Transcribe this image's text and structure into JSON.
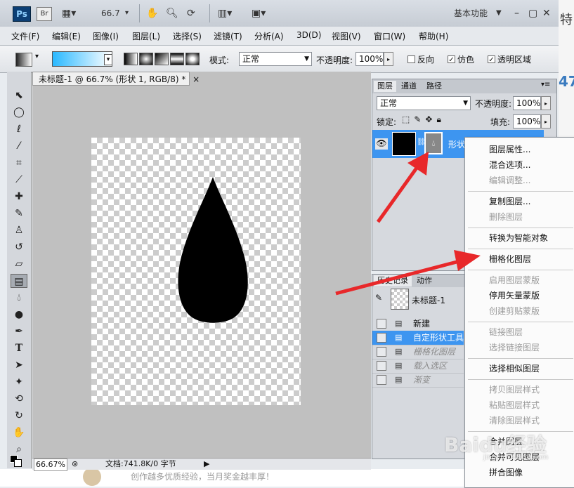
{
  "titlebar": {
    "ps_logo": "Ps",
    "br_logo": "Br",
    "zoom": "66.7",
    "workspace": "基本功能",
    "right_char": "特"
  },
  "menu": [
    "文件(F)",
    "编辑(E)",
    "图像(I)",
    "图层(L)",
    "选择(S)",
    "滤镜(T)",
    "分析(A)",
    "3D(D)",
    "视图(V)",
    "窗口(W)",
    "帮助(H)"
  ],
  "options": {
    "mode_label": "模式:",
    "mode_value": "正常",
    "opacity_label": "不透明度:",
    "opacity_value": "100%",
    "reverse_label": "反向",
    "dither_label": "仿色",
    "transparency_label": "透明区域",
    "dither_checked": "✓",
    "transparency_checked": "✓"
  },
  "document": {
    "tab_title": "未标题-1 @ 66.7% (形状 1, RGB/8) *",
    "tab_close": "×",
    "status_zoom": "66.67%",
    "status_doc": "文档:741.8K/0 字节"
  },
  "layers_panel": {
    "tabs": [
      "图层",
      "通道",
      "路径"
    ],
    "blend_mode": "正常",
    "opacity_label": "不透明度:",
    "opacity_value": "100%",
    "lock_label": "锁定:",
    "fill_label": "填充:",
    "fill_value": "100%",
    "layer_name": "形状"
  },
  "history_panel": {
    "tabs": [
      "历史记录",
      "动作"
    ],
    "snapshot": "未标题-1",
    "steps": [
      {
        "label": "新建",
        "active": false,
        "dim": false
      },
      {
        "label": "自定形状工具",
        "active": true,
        "dim": false
      },
      {
        "label": "栅格化图层",
        "active": false,
        "dim": true
      },
      {
        "label": "载入选区",
        "active": false,
        "dim": true
      },
      {
        "label": "渐变",
        "active": false,
        "dim": true
      }
    ]
  },
  "context_menu": {
    "groups": [
      [
        {
          "label": "图层属性...",
          "enabled": true
        },
        {
          "label": "混合选项...",
          "enabled": true
        },
        {
          "label": "编辑调整...",
          "enabled": false
        }
      ],
      [
        {
          "label": "复制图层...",
          "enabled": true
        },
        {
          "label": "删除图层",
          "enabled": false
        }
      ],
      [
        {
          "label": "转换为智能对象",
          "enabled": true
        }
      ],
      [
        {
          "label": "栅格化图层",
          "enabled": true
        }
      ],
      [
        {
          "label": "启用图层蒙版",
          "enabled": false
        },
        {
          "label": "停用矢量蒙版",
          "enabled": true
        },
        {
          "label": "创建剪贴蒙版",
          "enabled": false
        }
      ],
      [
        {
          "label": "链接图层",
          "enabled": false
        },
        {
          "label": "选择链接图层",
          "enabled": false
        }
      ],
      [
        {
          "label": "选择相似图层",
          "enabled": true
        }
      ],
      [
        {
          "label": "拷贝图层样式",
          "enabled": false
        },
        {
          "label": "粘贴图层样式",
          "enabled": false
        },
        {
          "label": "清除图层样式",
          "enabled": false
        }
      ],
      [
        {
          "label": "合并图层",
          "enabled": true
        },
        {
          "label": "合并可见图层",
          "enabled": true
        },
        {
          "label": "拼合图像",
          "enabled": true
        }
      ]
    ]
  },
  "watermark": {
    "text": "Baidu经验",
    "url": "jingyan.baidu.com"
  },
  "background": {
    "number_fragment": "47",
    "bottom_text": "创作越多优质经验，当月奖金越丰厚！"
  },
  "colors": {
    "accent": "#2f8fe8",
    "selection": "#3d95f0",
    "arrow": "#e8282a"
  }
}
